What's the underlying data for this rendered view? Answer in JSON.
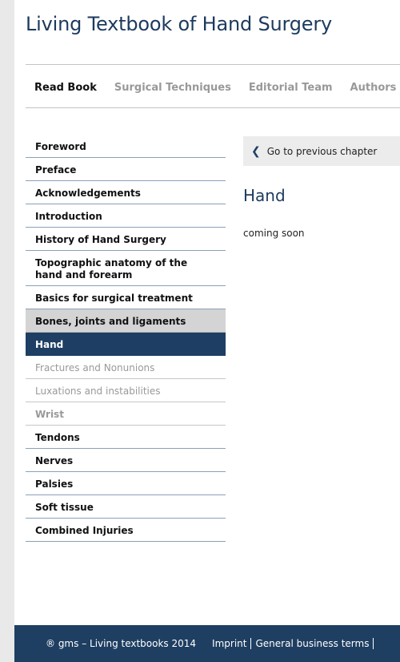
{
  "site": {
    "title": "Living Textbook of Hand Surgery"
  },
  "topnav": {
    "items": [
      {
        "label": "Read Book"
      },
      {
        "label": "Surgical Techniques"
      },
      {
        "label": "Editorial Team"
      },
      {
        "label": "Authors"
      }
    ]
  },
  "sidebar": {
    "items": [
      {
        "label": "Foreword"
      },
      {
        "label": "Preface"
      },
      {
        "label": "Acknowledgements"
      },
      {
        "label": "Introduction"
      },
      {
        "label": "History of Hand Surgery"
      },
      {
        "label": "Topographic anatomy of the hand and forearm"
      },
      {
        "label": "Basics for surgical treatment"
      },
      {
        "label": "Bones, joints and ligaments"
      },
      {
        "label": "Hand"
      },
      {
        "label": "Fractures and Nonunions"
      },
      {
        "label": "Luxations and instabilities"
      },
      {
        "label": "Wrist"
      },
      {
        "label": "Tendons"
      },
      {
        "label": "Nerves"
      },
      {
        "label": "Palsies"
      },
      {
        "label": "Soft tissue"
      },
      {
        "label": "Combined Injuries"
      }
    ]
  },
  "main": {
    "prev_label": "Go to previous chapter",
    "heading": "Hand",
    "body": "coming soon"
  },
  "footer": {
    "copyright": "® gms – Living textbooks 2014",
    "imprint": "Imprint",
    "terms": "General business terms"
  },
  "colors": {
    "brand": "#1e3f63",
    "selected_bg": "#1e3f63",
    "gray_bg": "#d4d4d4"
  }
}
